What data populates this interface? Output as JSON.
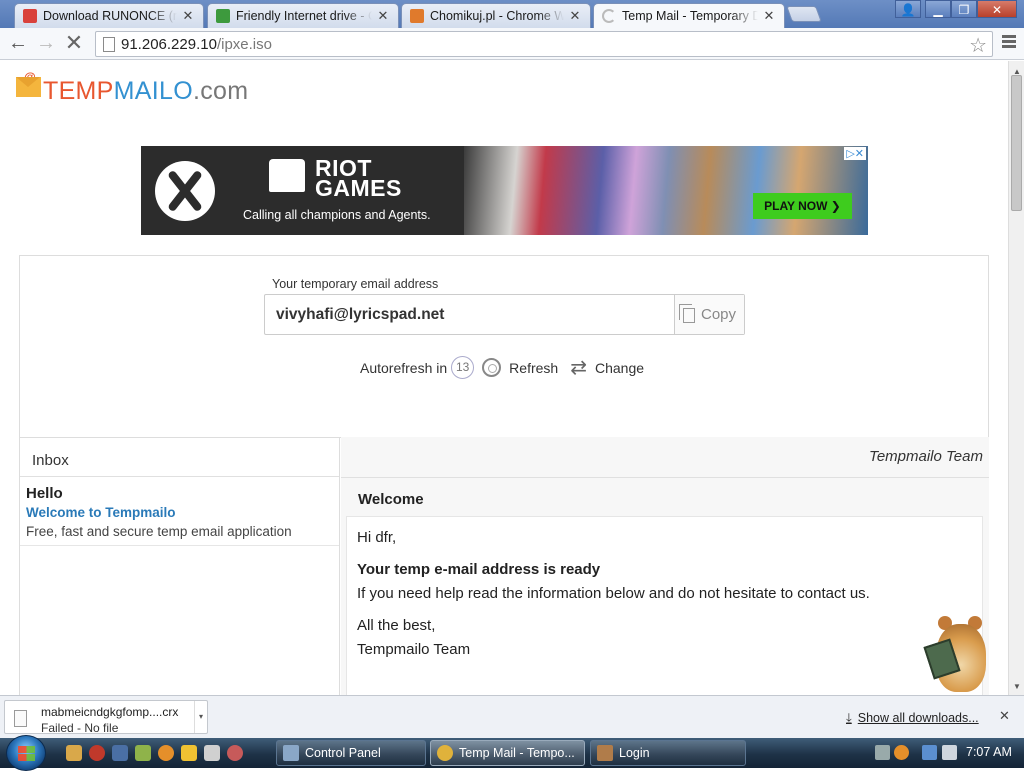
{
  "browser": {
    "tabs": [
      {
        "title": "Download RUNONCE (rem",
        "favicon_color": "#d9413b"
      },
      {
        "title": "Friendly Internet drive - Ch",
        "favicon_color": "#3d9a3d"
      },
      {
        "title": "Chomikuj.pl - Chrome We",
        "favicon_color": "#e07a2c"
      },
      {
        "title": "Temp Mail - Temporary D",
        "favicon_color": "#cfcfcf",
        "active": true
      }
    ],
    "url_host": "91.206.229.10",
    "url_path": "/ipxe.iso"
  },
  "site": {
    "logo": {
      "part1": "TEMP",
      "part2": "MAILO",
      "part3": ".com",
      "color1": "#e8572f",
      "color2": "#3391d1",
      "color3": "#777777"
    },
    "ad": {
      "brand": "RIOT\nGAMES",
      "tagline": "Calling all champions and Agents.",
      "cta": "PLAY NOW ❯"
    },
    "address_label": "Your temporary email address",
    "email": "vivyhafi@lyricspad.net",
    "copy_label": "Copy",
    "autorefresh_label": "Autorefresh in",
    "autorefresh_count": "13",
    "refresh_label": "Refresh",
    "change_label": "Change",
    "inbox": {
      "title": "Inbox",
      "items": [
        {
          "from": "Hello",
          "subject": "Welcome to Tempmailo",
          "preview": "Free, fast and secure temp email application"
        }
      ]
    },
    "message": {
      "sender": "Tempmailo Team",
      "subject": "Welcome",
      "greeting": "Hi dfr,",
      "headline": "Your temp e-mail address is ready",
      "body": "If you need help read the information below and do not hesitate to contact us.",
      "signoff1": "All the best,",
      "signoff2": "Tempmailo Team"
    }
  },
  "downloads": {
    "file": "mabmeicndgkgfomp....crx",
    "status": "Failed - No file",
    "show_all": "Show all downloads..."
  },
  "taskbar": {
    "buttons": [
      {
        "label": "Control Panel",
        "icon_color": "#8aa7c7"
      },
      {
        "label": "Temp Mail - Tempo...",
        "icon_color": "#e0b23b",
        "active": true
      },
      {
        "label": "Login",
        "icon_color": "#b07c4a"
      }
    ],
    "clock": "7:07 AM"
  }
}
